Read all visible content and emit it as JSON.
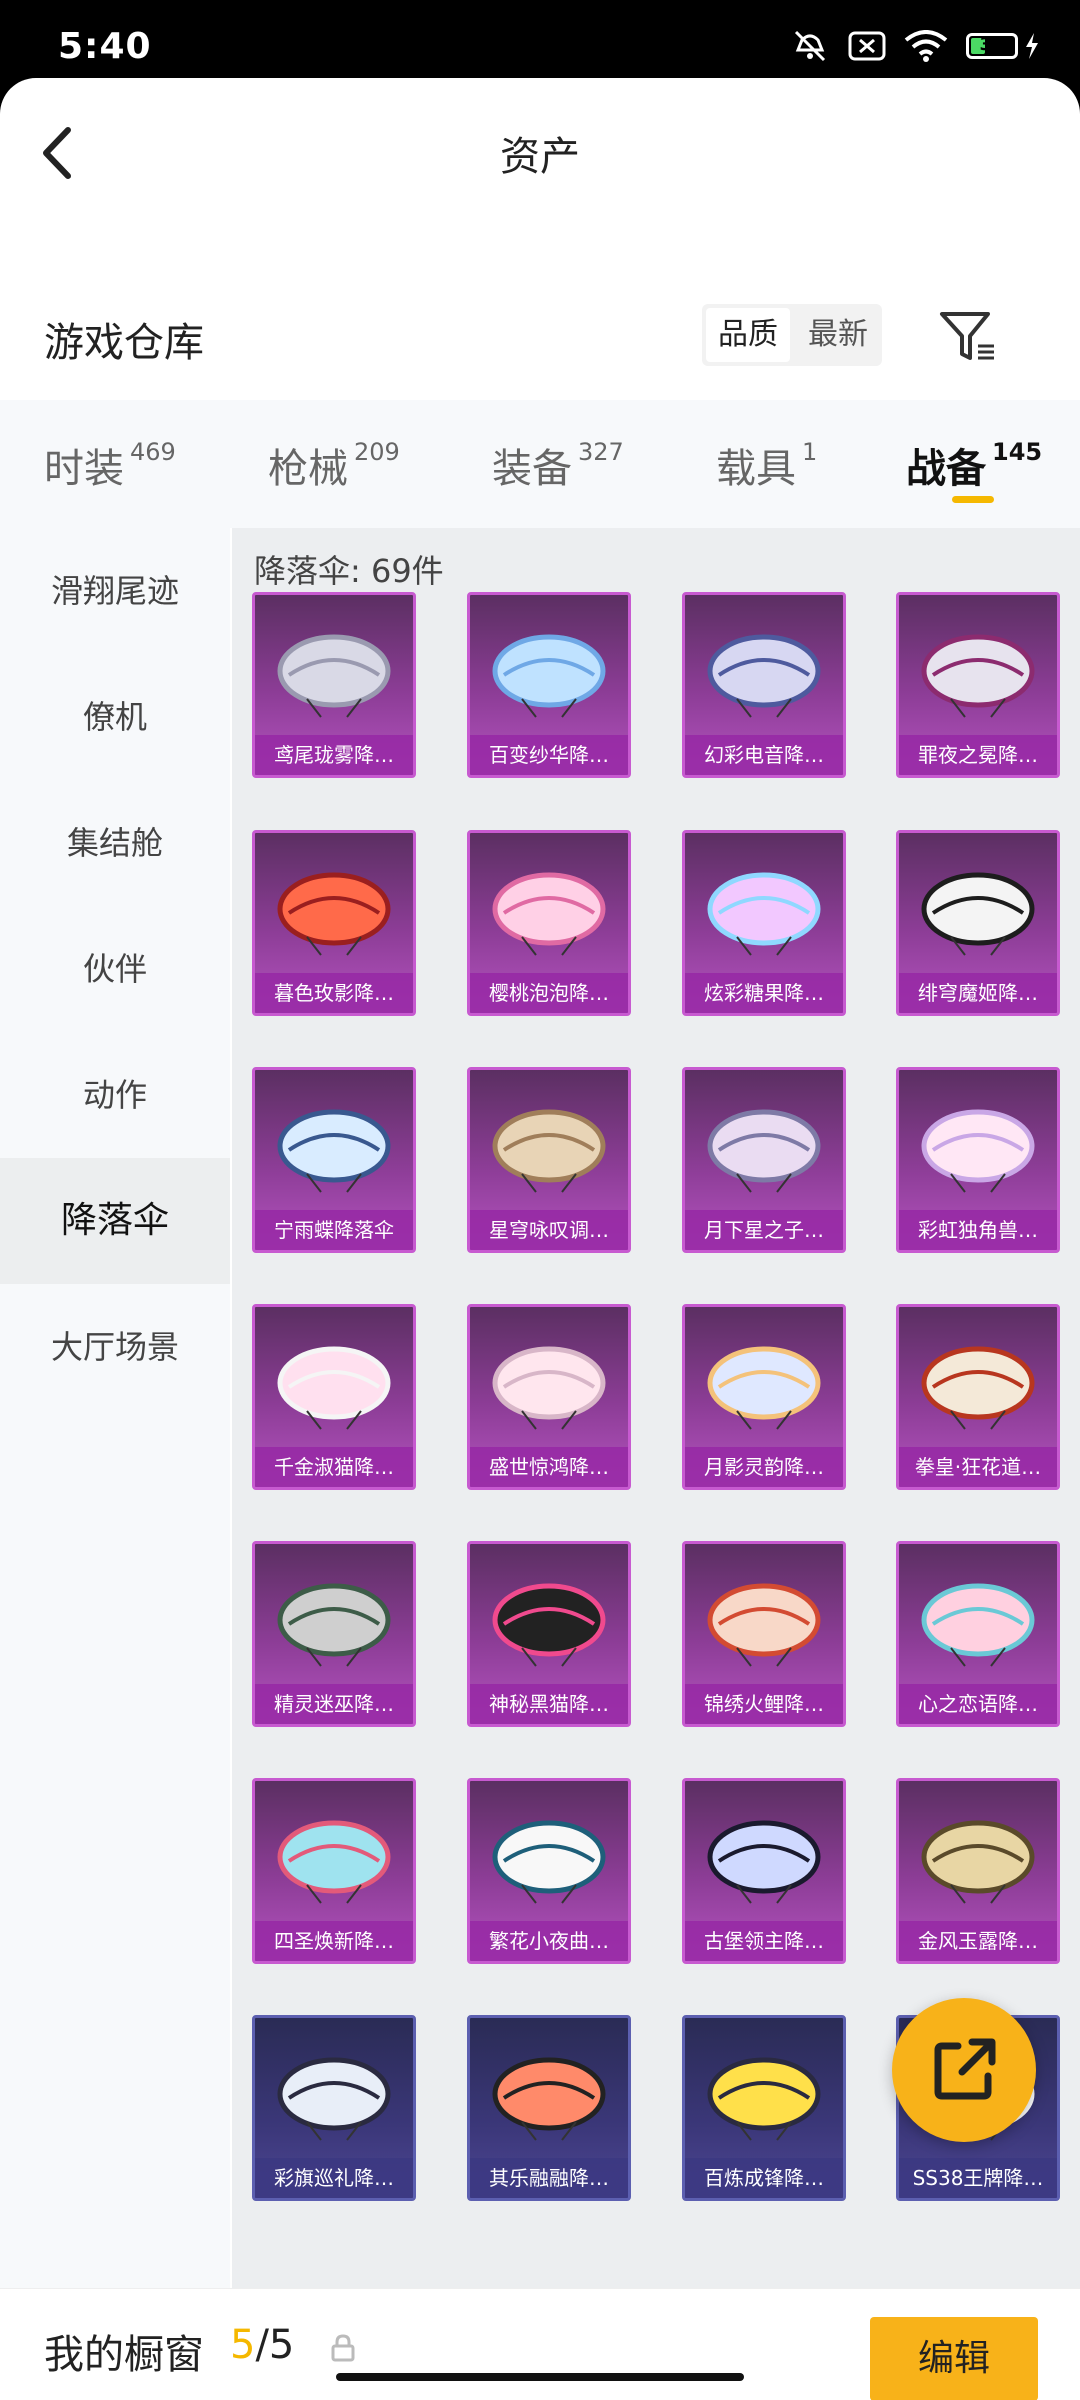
{
  "status_bar": {
    "time": "5:40",
    "battery": "31"
  },
  "header": {
    "title": "资产"
  },
  "warehouse": {
    "title": "游戏仓库",
    "sort_options": [
      "品质",
      "最新"
    ]
  },
  "categories": [
    {
      "label": "时装",
      "count": "469"
    },
    {
      "label": "枪械",
      "count": "209"
    },
    {
      "label": "装备",
      "count": "327"
    },
    {
      "label": "载具",
      "count": "1"
    },
    {
      "label": "战备",
      "count": "145"
    }
  ],
  "sidebar": [
    "滑翔尾迹",
    "僚机",
    "集结舱",
    "伙伴",
    "动作",
    "降落伞",
    "大厅场景"
  ],
  "grid": {
    "heading": "降落伞: 69件",
    "items": [
      "鸢尾珑雾降…",
      "百变纱华降…",
      "幻彩电音降…",
      "罪夜之冕降…",
      "暮色玫影降…",
      "樱桃泡泡降…",
      "炫彩糖果降…",
      "绯穹魔姬降…",
      "宁雨蝶降落伞",
      "星穹咏叹调…",
      "月下星之子…",
      "彩虹独角兽…",
      "千金淑猫降…",
      "盛世惊鸿降…",
      "月影灵韵降…",
      "拳皇·狂花道…",
      "精灵迷巫降…",
      "神秘黑猫降…",
      "锦绣火鲤降…",
      "心之恋语降…",
      "四圣焕新降…",
      "繁花小夜曲…",
      "古堡领主降…",
      "金风玉露降…",
      "彩旗巡礼降…",
      "其乐融融降…",
      "百炼成锋降…",
      "SS38王牌降…"
    ]
  },
  "footer": {
    "label": "我的橱窗",
    "count_current": "5",
    "count_total": "/5",
    "edit_label": "编辑"
  },
  "colors": {
    "accent": "#f8b219",
    "card_purple": "#8d3d97"
  }
}
